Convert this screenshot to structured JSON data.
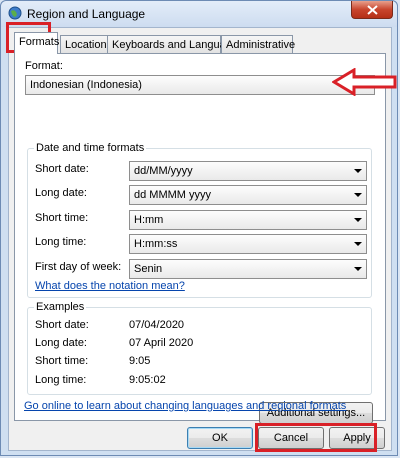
{
  "window": {
    "title": "Region and Language",
    "close_icon": "close-icon"
  },
  "tabs": [
    {
      "label": "Formats",
      "active": true
    },
    {
      "label": "Location",
      "active": false
    },
    {
      "label": "Keyboards and Languages",
      "active": false
    },
    {
      "label": "Administrative",
      "active": false
    }
  ],
  "format": {
    "label": "Format:",
    "value": "Indonesian (Indonesia)"
  },
  "date_time": {
    "title": "Date and time formats",
    "rows": [
      {
        "label": "Short date:",
        "value": "dd/MM/yyyy"
      },
      {
        "label": "Long date:",
        "value": "dd MMMM yyyy"
      },
      {
        "label": "Short time:",
        "value": "H:mm"
      },
      {
        "label": "Long time:",
        "value": "H:mm:ss"
      },
      {
        "label": "First day of week:",
        "value": "Senin"
      }
    ],
    "notation_link": "What does the notation mean?"
  },
  "examples": {
    "title": "Examples",
    "rows": [
      {
        "label": "Short date:",
        "value": "07/04/2020"
      },
      {
        "label": "Long date:",
        "value": "07 April 2020"
      },
      {
        "label": "Short time:",
        "value": "9:05"
      },
      {
        "label": "Long time:",
        "value": "9:05:02"
      }
    ]
  },
  "additional_settings_label": "Additional settings...",
  "online_link": "Go online to learn about changing languages and regional formats",
  "buttons": {
    "ok": "OK",
    "cancel": "Cancel",
    "apply": "Apply"
  },
  "colors": {
    "highlight": "#d92027",
    "link": "#0645ad"
  }
}
